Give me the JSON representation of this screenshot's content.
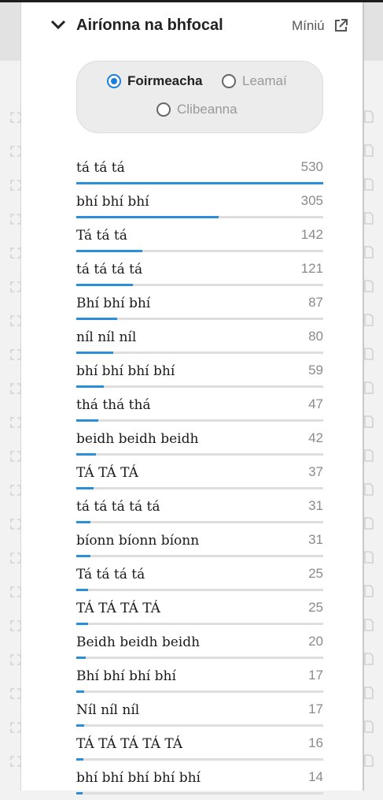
{
  "panel": {
    "title": "Airíonna na bhfocal",
    "explain_label": "Míniú",
    "icons": {
      "collapse": "chevron-down-icon",
      "external": "external-link-icon"
    }
  },
  "radio_options": [
    {
      "label": "Foirmeacha",
      "selected": true
    },
    {
      "label": "Leamaí",
      "selected": false
    },
    {
      "label": "Clibeanna",
      "selected": false
    }
  ],
  "accent_color": "#2b8ed8",
  "frequency_list": [
    {
      "word": "tá tá tá",
      "count": "530",
      "share": 1.0
    },
    {
      "word": "bhí bhí bhí",
      "count": "305",
      "share": 0.576
    },
    {
      "word": "Tá tá tá",
      "count": "142",
      "share": 0.268
    },
    {
      "word": "tá tá tá tá",
      "count": "121",
      "share": 0.228
    },
    {
      "word": "Bhí bhí bhí",
      "count": "87",
      "share": 0.164
    },
    {
      "word": "níl níl níl",
      "count": "80",
      "share": 0.151
    },
    {
      "word": "bhí bhí bhí bhí",
      "count": "59",
      "share": 0.111
    },
    {
      "word": "thá thá thá",
      "count": "47",
      "share": 0.089
    },
    {
      "word": "beidh beidh beidh",
      "count": "42",
      "share": 0.079
    },
    {
      "word": "TÁ TÁ TÁ",
      "count": "37",
      "share": 0.07
    },
    {
      "word": "tá tá tá tá tá",
      "count": "31",
      "share": 0.058
    },
    {
      "word": "bíonn bíonn bíonn",
      "count": "31",
      "share": 0.058
    },
    {
      "word": "Tá tá tá tá",
      "count": "25",
      "share": 0.047
    },
    {
      "word": "TÁ TÁ TÁ TÁ",
      "count": "25",
      "share": 0.047
    },
    {
      "word": "Beidh beidh beidh",
      "count": "20",
      "share": 0.038
    },
    {
      "word": "Bhí bhí bhí bhí",
      "count": "17",
      "share": 0.032
    },
    {
      "word": "Níl níl níl",
      "count": "17",
      "share": 0.032
    },
    {
      "word": "TÁ TÁ TÁ TÁ TÁ",
      "count": "16",
      "share": 0.03
    },
    {
      "word": "bhí bhí bhí bhí bhí",
      "count": "14",
      "share": 0.026
    }
  ]
}
